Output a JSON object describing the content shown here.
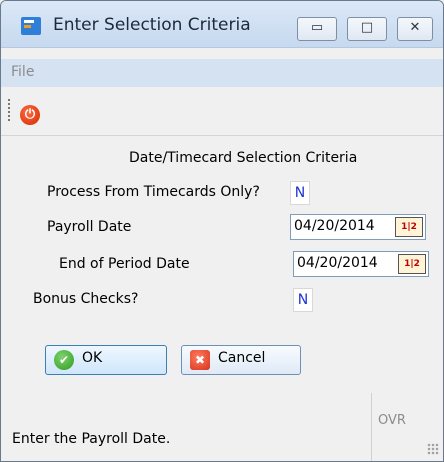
{
  "window": {
    "title": "Enter Selection Criteria"
  },
  "menu": {
    "file": "File"
  },
  "form": {
    "section_title": "Date/Timecard Selection Criteria",
    "process_from_timecards_label": "Process From Timecards Only?",
    "process_from_timecards_value": "N",
    "payroll_date_label": "Payroll Date",
    "payroll_date_value": "04/20/2014",
    "end_of_period_label": "End of Period Date",
    "end_of_period_value": "04/20/2014",
    "bonus_checks_label": "Bonus Checks?",
    "bonus_checks_value": "N"
  },
  "buttons": {
    "ok": "OK",
    "cancel": "Cancel"
  },
  "status": {
    "message": "Enter the Payroll Date.",
    "mode": "OVR"
  },
  "icons": {
    "app": "app-icon",
    "power": "power-icon",
    "calendar": "calendar-icon",
    "ok": "check-icon",
    "cancel": "cancel-icon"
  }
}
